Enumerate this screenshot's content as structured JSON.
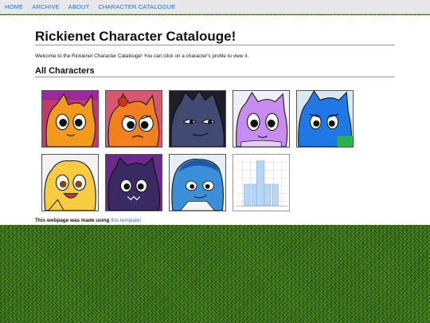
{
  "nav": {
    "items": [
      "HOME",
      "ARCHIVE",
      "ABOUT",
      "CHARACTER CATALOGUE"
    ]
  },
  "page": {
    "title": "Rickienet Character Catalouge!",
    "intro": "Welcome to the Rickienet Character Catalouge! You can click on a character's profile to view it.",
    "section_heading": "All Characters",
    "footer_text": "This webpage was made using",
    "footer_link": "this template!"
  },
  "characters": [
    {
      "name": "orange-character-profile",
      "color": "#f39a1c"
    },
    {
      "name": "orange-red-character-profile",
      "color": "#f2801e"
    },
    {
      "name": "dark-navy-character-profile",
      "color": "#414a72"
    },
    {
      "name": "purple-character-profile",
      "color": "#c88bef"
    },
    {
      "name": "blue-character-profile",
      "color": "#1f78e6"
    },
    {
      "name": "yellow-character-profile",
      "color": "#f8cc42"
    },
    {
      "name": "dark-purple-character-profile",
      "color": "#3a2a63"
    },
    {
      "name": "light-blue-character-profile",
      "color": "#3b8ed8"
    },
    {
      "name": "chart-thumbnail-profile",
      "color": "#b6d6f4"
    }
  ],
  "colors": {
    "link": "#2a6fc4",
    "nav_bg": "#e8e8ea",
    "ground": "#3f7a1c"
  }
}
